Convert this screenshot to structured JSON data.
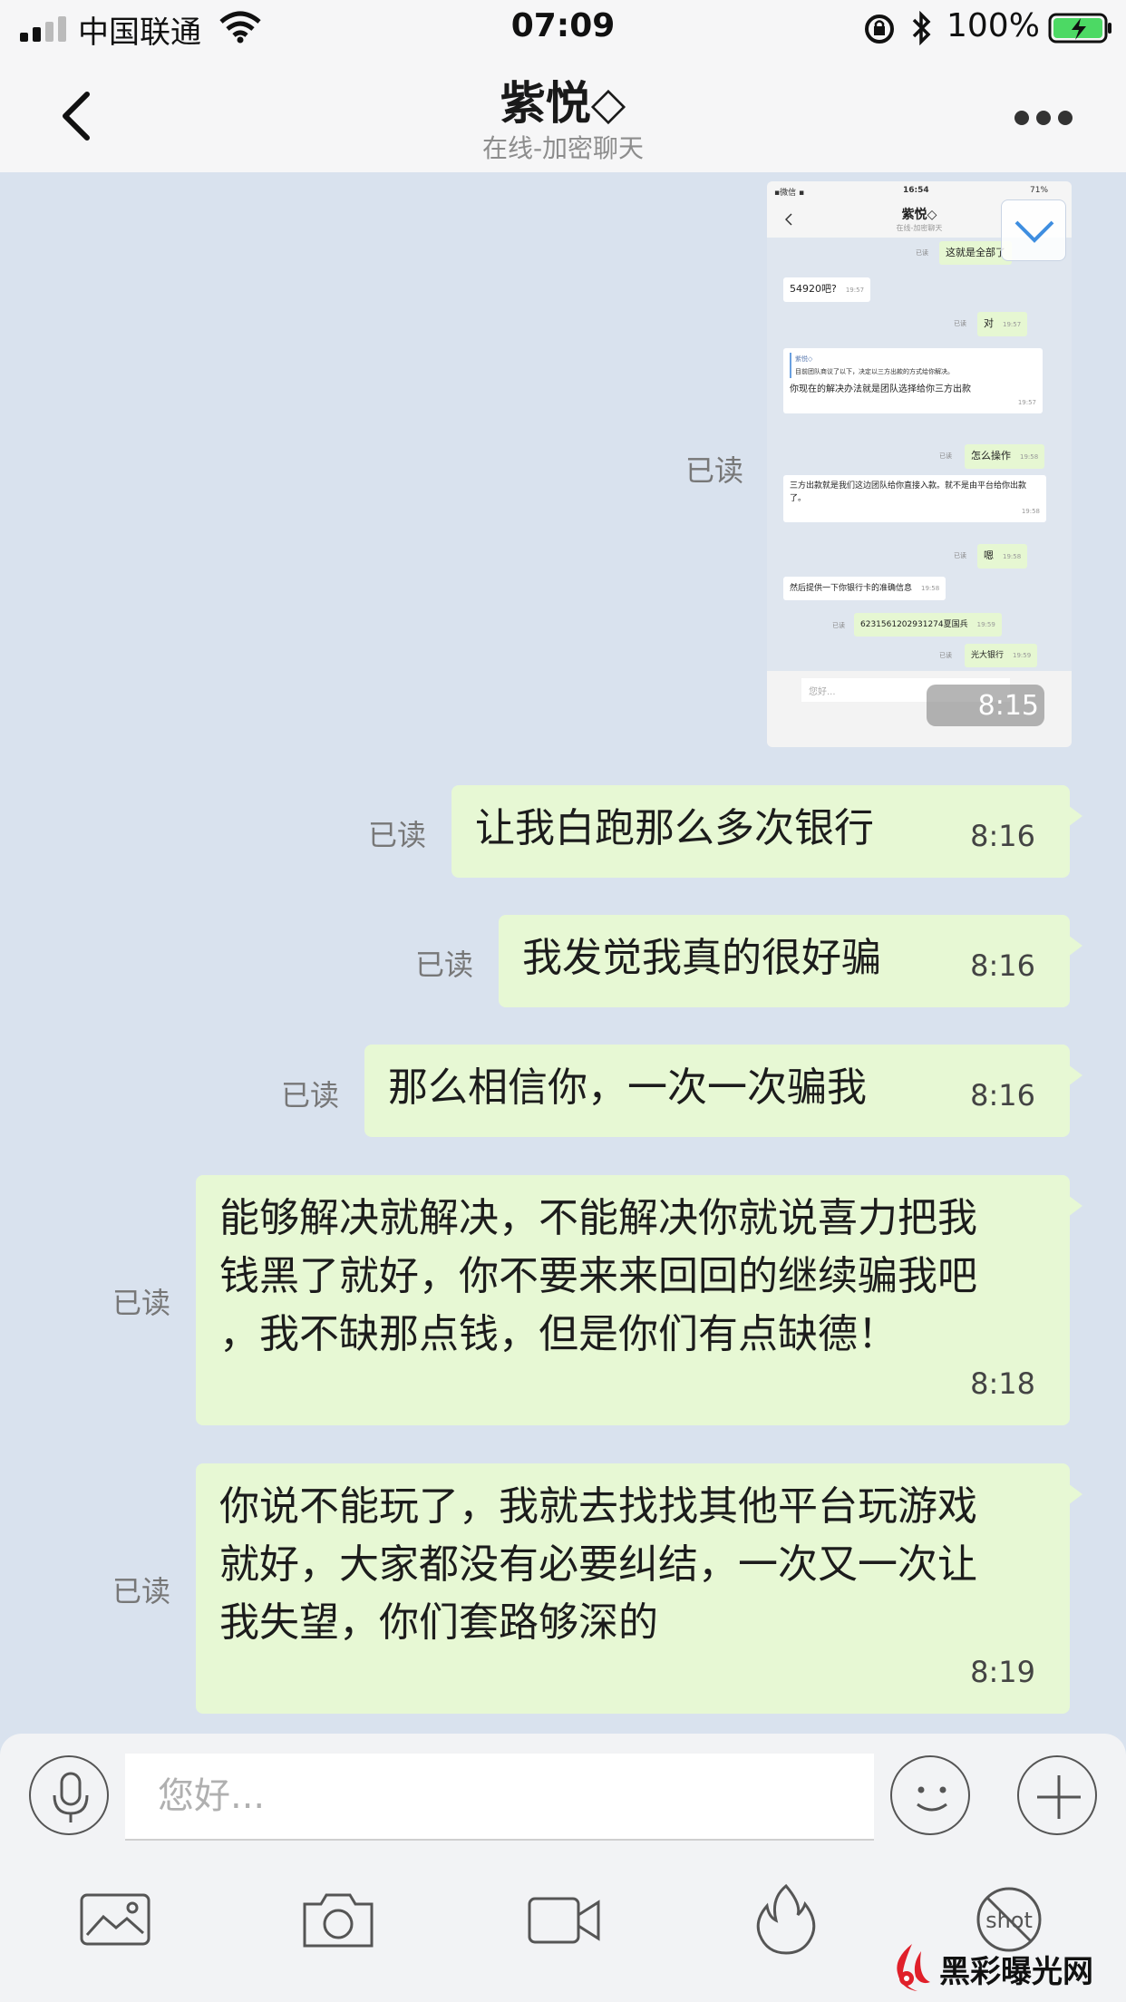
{
  "status_bar": {
    "carrier": "中国联通",
    "time": "07:09",
    "battery": "100%"
  },
  "nav": {
    "title": "紫悦◇",
    "subtitle": "在线-加密聊天"
  },
  "embedded_screenshot": {
    "status_carrier": "▪微信 ▪",
    "status_time": "16:54",
    "status_battery": "71%",
    "title": "紫悦◇",
    "subtitle": "在线-加密聊天",
    "read_label": "已读",
    "messages": [
      {
        "text": "这就是全部了",
        "time": ""
      },
      {
        "text": "54920吧?",
        "time": "19:57"
      },
      {
        "text": "对",
        "time": "19:57"
      },
      {
        "quote": "紫悦◇",
        "quote_text": "目前团队商议了以下，决定以三方出款的方式给你解决。",
        "text": "你现在的解决办法就是团队选择给你三方出款",
        "time": "19:57"
      },
      {
        "text": "怎么操作",
        "time": "19:58"
      },
      {
        "text": "三方出款就是我们这边团队给你直接入款。就不是由平台给你出款了。",
        "time": "19:58"
      },
      {
        "text": "嗯",
        "time": "19:58"
      },
      {
        "text": "然后提供一下你银行卡的准确信息",
        "time": "19:58"
      },
      {
        "text": "6231561202931274夏国兵",
        "time": "19:59"
      },
      {
        "text": "光大银行",
        "time": "19:59"
      }
    ],
    "input_placeholder": "您好...",
    "timestamp": "8:15"
  },
  "read_label": "已读",
  "messages": [
    {
      "text": "让我白跑那么多次银行",
      "time": "8:16",
      "read": "已读"
    },
    {
      "text": "我发觉我真的很好骗",
      "time": "8:16",
      "read": "已读"
    },
    {
      "text": "那么相信你，一次一次骗我",
      "time": "8:16",
      "read": "已读"
    },
    {
      "text": "能够解决就解决，不能解决你就说喜力把我\n钱黑了就好，你不要来来回回的继续骗我吧\n，我不缺那点钱，但是你们有点缺德！",
      "time": "8:18",
      "read": "已读"
    },
    {
      "text": "你说不能玩了，我就去找找其他平台玩游戏\n就好，大家都没有必要纠结，一次又一次让\n我失望，你们套路够深的",
      "time": "8:19",
      "read": "已读"
    }
  ],
  "input": {
    "placeholder": "您好..."
  },
  "toolbar": {
    "icons": [
      "image-icon",
      "camera-icon",
      "video-icon",
      "fire-icon",
      "no-screenshot-icon"
    ],
    "screenshot_label": "shot"
  },
  "watermark": {
    "text": "黑彩曝光网"
  },
  "colors": {
    "chat_background": "#d9e2ee",
    "outgoing_bubble": "#e7f8d4",
    "bars": "#f6f6f7",
    "battery_green": "#4cd964"
  }
}
